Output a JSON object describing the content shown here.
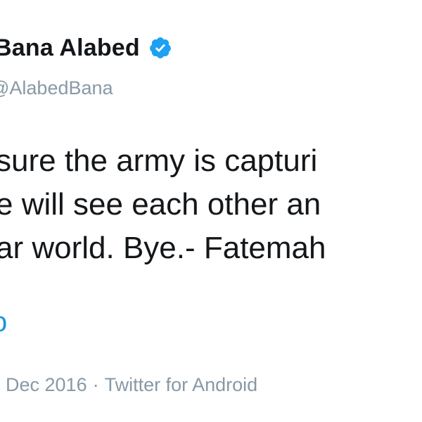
{
  "author": {
    "display_name": "Bana Alabed",
    "handle": "@AlabedBana",
    "verified_icon": "verified-badge-icon",
    "verified_color": "#1da1f2"
  },
  "tweet": {
    "lines": [
      "sure the army is capturi",
      "e will see each other an",
      "ar world. Bye.- Fatemah"
    ],
    "translate_link": "o",
    "date": "Dec 2016",
    "separator": "·",
    "source": "Twitter for Android"
  }
}
